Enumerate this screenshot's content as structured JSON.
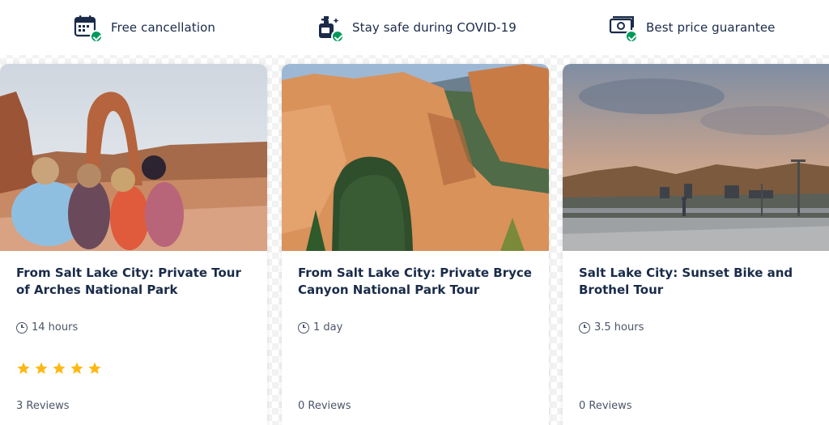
{
  "features": [
    {
      "icon": "calendar-check-icon",
      "label": "Free cancellation"
    },
    {
      "icon": "sanitizer-check-icon",
      "label": "Stay safe during COVID-19"
    },
    {
      "icon": "money-check-icon",
      "label": "Best price guarantee"
    }
  ],
  "cards": [
    {
      "title": "From Salt Lake City: Private Tour of Arches National Park",
      "duration": "14 hours",
      "rating": 5,
      "reviews": "3 Reviews"
    },
    {
      "title": "From Salt Lake City: Private Bryce Canyon National Park Tour",
      "duration": "1 day",
      "reviews": "0 Reviews"
    },
    {
      "title": "Salt Lake City: Sunset Bike and Brothel Tour",
      "duration": "3.5 hours",
      "reviews": "0 Reviews"
    }
  ],
  "colors": {
    "text": "#1a2b49",
    "muted": "#4a5568",
    "check": "#00995c",
    "star": "#fdb813"
  }
}
